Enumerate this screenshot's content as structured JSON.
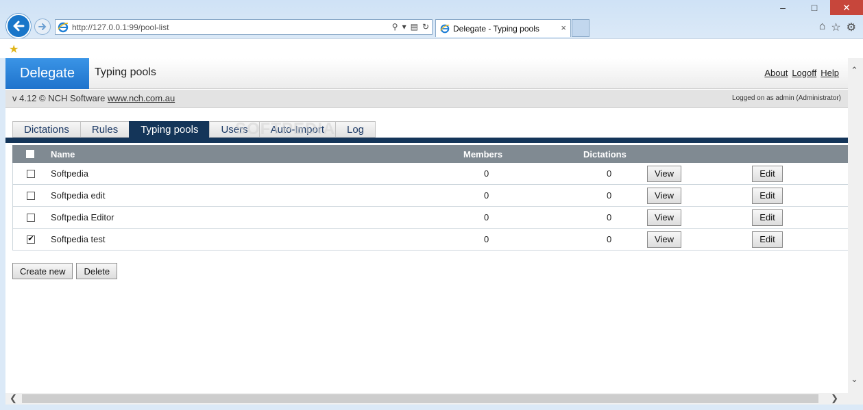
{
  "browser": {
    "url": "http://127.0.0.1:99/pool-list",
    "tab_title": "Delegate - Typing pools",
    "tab_close": "×"
  },
  "app": {
    "brand": "Delegate",
    "page_title": "Typing pools",
    "links": [
      "About",
      "Logoff",
      "Help"
    ],
    "version_prefix": "v 4.12 © NCH Software ",
    "version_link": "www.nch.com.au",
    "logged_on": "Logged on as admin (Administrator)"
  },
  "tabs": [
    {
      "label": "Dictations",
      "active": false
    },
    {
      "label": "Rules",
      "active": false
    },
    {
      "label": "Typing pools",
      "active": true
    },
    {
      "label": "Users",
      "active": false
    },
    {
      "label": "Auto-Import",
      "active": false
    },
    {
      "label": "Log",
      "active": false
    }
  ],
  "watermark": "SOFTPEDIA",
  "table": {
    "columns": {
      "name": "Name",
      "members": "Members",
      "dictations": "Dictations"
    },
    "rows": [
      {
        "name": "Softpedia",
        "members": "0",
        "dictations": "0",
        "checked": false,
        "view": "View",
        "edit": "Edit"
      },
      {
        "name": "Softpedia edit",
        "members": "0",
        "dictations": "0",
        "checked": false,
        "view": "View",
        "edit": "Edit"
      },
      {
        "name": "Softpedia Editor",
        "members": "0",
        "dictations": "0",
        "checked": false,
        "view": "View",
        "edit": "Edit"
      },
      {
        "name": "Softpedia test",
        "members": "0",
        "dictations": "0",
        "checked": true,
        "view": "View",
        "edit": "Edit"
      }
    ]
  },
  "actions": {
    "create": "Create new",
    "delete": "Delete"
  }
}
